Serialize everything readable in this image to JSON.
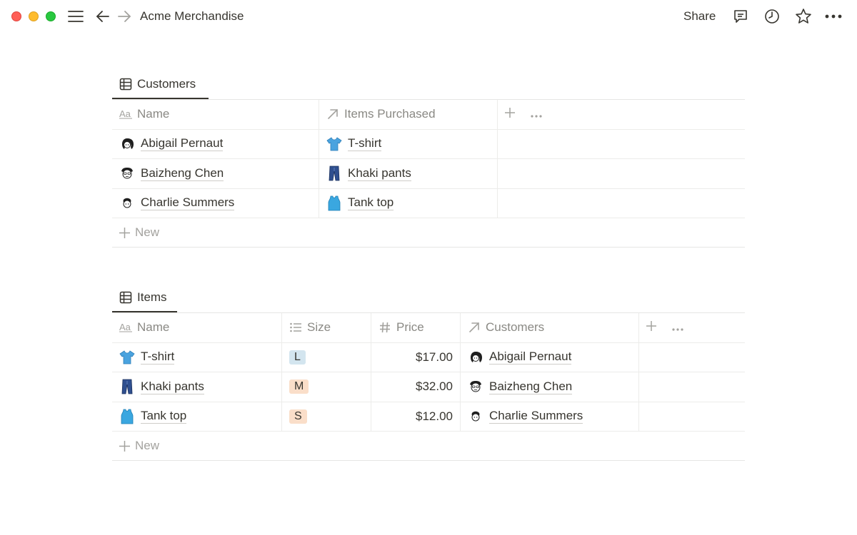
{
  "window": {
    "title": "Acme Merchandise",
    "share_label": "Share"
  },
  "colors": {
    "text": "#37352f",
    "muted": "#8a8984",
    "border": "#ececea",
    "tag_blue": "#d3e5ef",
    "tag_orange": "#fadec9",
    "shirt": "#4aa3df"
  },
  "customers_db": {
    "tab_label": "Customers",
    "columns": [
      {
        "label": "Name",
        "icon": "title-aa-icon"
      },
      {
        "label": "Items Purchased",
        "icon": "relation-arrow-icon"
      }
    ],
    "rows": [
      {
        "name": "Abigail Pernaut",
        "avatar": "avatar-abigail-icon",
        "item": "T-shirt",
        "item_icon": "tshirt-icon"
      },
      {
        "name": "Baizheng Chen",
        "avatar": "avatar-baizheng-icon",
        "item": "Khaki pants",
        "item_icon": "jeans-icon"
      },
      {
        "name": "Charlie Summers",
        "avatar": "avatar-charlie-icon",
        "item": "Tank top",
        "item_icon": "tanktop-icon"
      }
    ],
    "new_label": "New"
  },
  "items_db": {
    "tab_label": "Items",
    "columns": [
      {
        "label": "Name",
        "icon": "title-aa-icon"
      },
      {
        "label": "Size",
        "icon": "list-icon"
      },
      {
        "label": "Price",
        "icon": "hash-icon"
      },
      {
        "label": "Customers",
        "icon": "relation-arrow-icon"
      }
    ],
    "rows": [
      {
        "name": "T-shirt",
        "size": "L",
        "price": "$17.00",
        "customer": "Abigail Pernaut"
      },
      {
        "name": "Khaki pants",
        "size": "M",
        "price": "$32.00",
        "customer": "Baizheng Chen"
      },
      {
        "name": "Tank top",
        "size": "S",
        "price": "$12.00",
        "customer": "Charlie Summers"
      }
    ],
    "new_label": "New"
  }
}
